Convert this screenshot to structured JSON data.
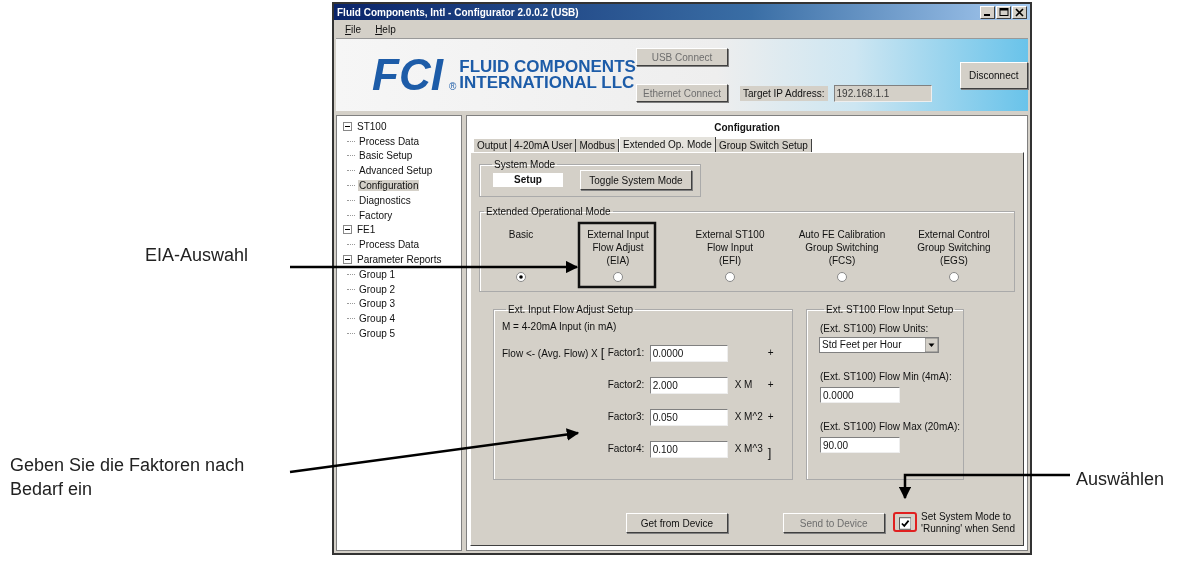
{
  "window": {
    "title": "Fluid Components, Intl - Configurator 2.0.0.2 (USB)",
    "menu": [
      "File",
      "Help"
    ]
  },
  "header": {
    "logo_mark": "FCI",
    "logo_reg": "®",
    "logo_lines": [
      "FLUID COMPONENTS",
      "INTERNATIONAL LLC"
    ],
    "usb_button": {
      "label": "USB Connect",
      "disabled": true
    },
    "ethernet_button": {
      "label": "Ethernet Connect",
      "disabled": true
    },
    "ip_label": "Target IP Address:",
    "ip_field": {
      "value": "192.168.1.1",
      "disabled": true
    },
    "disconnect_button": {
      "label": "Disconnect",
      "disabled": false
    }
  },
  "tree": [
    {
      "label": "ST100",
      "expanded": true,
      "selected": false,
      "children": [
        {
          "label": "Process Data",
          "selected": false
        },
        {
          "label": "Basic Setup",
          "selected": false
        },
        {
          "label": "Advanced Setup",
          "selected": false
        },
        {
          "label": "Configuration",
          "selected": true
        },
        {
          "label": "Diagnostics",
          "selected": false
        },
        {
          "label": "Factory",
          "selected": false
        }
      ]
    },
    {
      "label": "FE1",
      "expanded": true,
      "selected": false,
      "children": [
        {
          "label": "Process Data",
          "selected": false
        }
      ]
    },
    {
      "label": "Parameter Reports",
      "expanded": true,
      "selected": false,
      "children": [
        {
          "label": "Group 1",
          "selected": false
        },
        {
          "label": "Group 2",
          "selected": false
        },
        {
          "label": "Group 3",
          "selected": false
        },
        {
          "label": "Group 4",
          "selected": false
        },
        {
          "label": "Group 5",
          "selected": false
        }
      ]
    }
  ],
  "panel": {
    "title": "Configuration",
    "tabs": [
      {
        "label": "Output",
        "selected": false
      },
      {
        "label": "4-20mA User",
        "selected": false
      },
      {
        "label": "Modbus",
        "selected": false
      },
      {
        "label": "Extended Op. Mode",
        "selected": true
      },
      {
        "label": "Group Switch Setup",
        "selected": false
      }
    ],
    "system_mode": {
      "title": "System Mode",
      "value": "Setup",
      "button": "Toggle System Mode"
    },
    "operational_mode": {
      "title": "Extended Operational Mode",
      "options": [
        {
          "lines": [
            "Basic"
          ],
          "selected": true
        },
        {
          "lines": [
            "External Input",
            "Flow Adjust",
            "(EIA)"
          ],
          "selected": false
        },
        {
          "lines": [
            "External ST100",
            "Flow Input",
            "(EFI)"
          ],
          "selected": false
        },
        {
          "lines": [
            "Auto FE Calibration",
            "Group Switching",
            "(FCS)"
          ],
          "selected": false
        },
        {
          "lines": [
            "External Control",
            "Group Switching",
            "(EGS)"
          ],
          "selected": false
        }
      ]
    },
    "flow_adjust": {
      "title": "Ext. Input Flow Adjust Setup",
      "note": "M = 4-20mA Input (in mA)",
      "formula": "Flow <- (Avg. Flow) X",
      "open_bracket": "[",
      "factors": [
        {
          "label": "Factor1:",
          "value": "0.0000",
          "operator": "+"
        },
        {
          "label": "Factor2:",
          "value": "2.000",
          "suffix": "X M",
          "operator": "+"
        },
        {
          "label": "Factor3:",
          "value": "0.050",
          "suffix": "X M^2",
          "operator": "+"
        },
        {
          "label": "Factor4:",
          "value": "0.100",
          "suffix": "X M^3",
          "operator": "]"
        }
      ]
    },
    "st100_input": {
      "title": "Ext. ST100 Flow Input Setup",
      "units_label": "(Ext. ST100) Flow Units:",
      "units_value": "Std Feet per Hour",
      "min_label": "(Ext. ST100) Flow Min (4mA):",
      "min_value": "0.0000",
      "max_label": "(Ext. ST100) Flow Max (20mA):",
      "max_value": "90.00"
    },
    "buttons": [
      {
        "label": "Get from Device",
        "disabled": false
      },
      {
        "label": "Send to Device",
        "disabled": true
      }
    ],
    "running_checkbox": {
      "lines": [
        "Set System Mode to",
        "'Running' when Send"
      ],
      "checked": true
    }
  },
  "callouts": [
    {
      "text": "EIA-Auswahl"
    },
    {
      "text": "Geben Sie die Faktoren nach Bedarf ein"
    },
    {
      "text": "Auswählen"
    }
  ]
}
